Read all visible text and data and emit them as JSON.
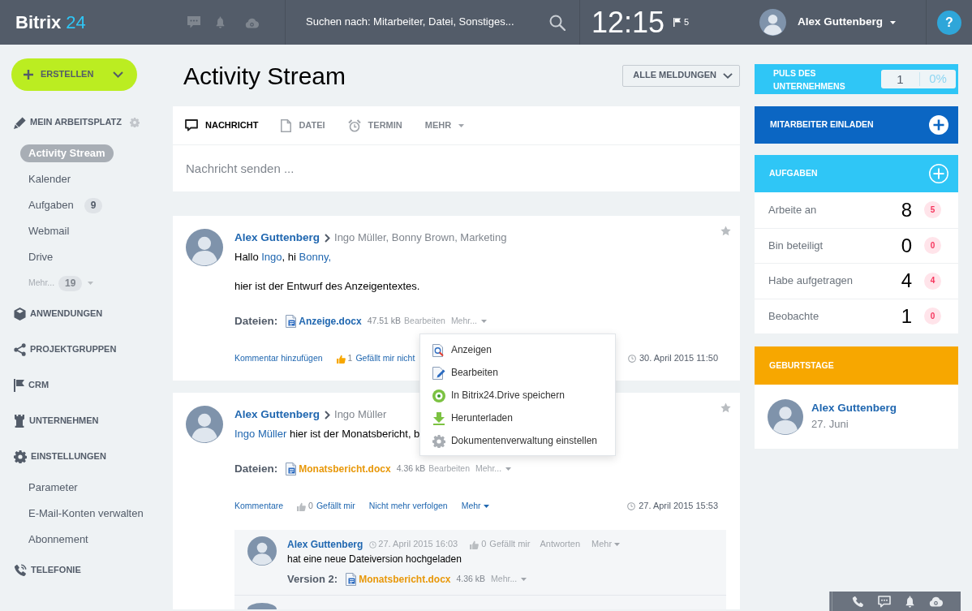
{
  "header": {
    "logo": {
      "text": "Bitrix",
      "number": "24"
    },
    "search": {
      "placeholder": "Suchen nach: Mitarbeiter, Datei, Sonstiges..."
    },
    "clock": "12:15",
    "flag_count": "5",
    "user": {
      "name": "Alex Guttenberg"
    },
    "help": "?"
  },
  "sidebar": {
    "create_button": "ERSTELLEN",
    "sections": [
      {
        "title": "MEIN ARBEITSPLATZ",
        "items": [
          {
            "kind": "link",
            "label": "Activity Stream",
            "selected": true
          },
          {
            "kind": "link",
            "label": "Kalender",
            "selected": false
          },
          {
            "kind": "link",
            "label": "Aufgaben",
            "count": "9",
            "selected": false
          },
          {
            "kind": "link",
            "label": "Webmail",
            "selected": false
          },
          {
            "kind": "link",
            "label": "Drive",
            "selected": false
          },
          {
            "kind": "more",
            "label": "Mehr...",
            "count": "19",
            "selected": false
          }
        ]
      },
      {
        "title": "ANWENDUNGEN"
      },
      {
        "title": "PROJEKTGRUPPEN"
      },
      {
        "title": "CRM"
      },
      {
        "title": "UNTERNEHMEN"
      },
      {
        "title": "EINSTELLUNGEN",
        "items": [
          {
            "kind": "link",
            "label": "Parameter",
            "selected": false
          },
          {
            "kind": "link",
            "label": "E-Mail-Konten verwalten",
            "selected": false
          },
          {
            "kind": "link",
            "label": "Abonnement",
            "selected": false
          }
        ]
      },
      {
        "title": "TELEFONIE"
      }
    ]
  },
  "main": {
    "title": "Activity Stream",
    "filter_button": "ALLE MELDUNGEN",
    "composer": {
      "tabs": [
        {
          "kind": "tab",
          "label": "NACHRICHT",
          "selected": true
        },
        {
          "kind": "tab",
          "label": "DATEI",
          "selected": false
        },
        {
          "kind": "tab",
          "label": "TERMIN",
          "selected": false
        },
        {
          "kind": "menu",
          "label": "MEHR",
          "selected": false
        }
      ],
      "placeholder": "Nachricht senden ..."
    },
    "posts": [
      {
        "author": "Alex Guttenberg",
        "recipients": "Ingo Müller, Bonny Brown, Marketing",
        "paragraphs": [
          [
            {
              "text": "Hallo ",
              "link": false
            },
            {
              "text": "Ingo",
              "link": true
            },
            {
              "text": ", hi ",
              "link": false
            },
            {
              "text": "Bonny,",
              "link": true
            }
          ],
          [
            {
              "text": "hier ist der Entwurf des Anzeigentextes.",
              "link": false
            }
          ]
        ],
        "files": {
          "label": "Dateien:",
          "items": [
            {
              "name": "Anzeige.docx",
              "size": "47.51 kB",
              "edit": "Bearbeiten",
              "more": "Mehr...",
              "color": "#2067b0",
              "menu": {
                "items": [
                  "Anzeigen",
                  "Bearbeiten",
                  "In Bitrix24.Drive speichern",
                  "Herunterladen",
                  "Dokumentenverwaltung einstellen"
                ]
              }
            }
          ]
        },
        "actions": [
          {
            "kind": "link",
            "label": "Kommentar hinzufügen"
          },
          {
            "kind": "like",
            "count": "1",
            "label": "Gefällt mir nicht",
            "liked": true
          }
        ],
        "date": "30. April 2015 11:50"
      },
      {
        "author": "Alex Guttenberg",
        "recipients": "Ingo Müller",
        "paragraphs": [
          [
            {
              "text": "Ingo Müller",
              "link": true
            },
            {
              "text": " hier ist der Monatsbericht, b",
              "link": false
            }
          ]
        ],
        "files": {
          "label": "Dateien:",
          "items": [
            {
              "name": "Monatsbericht.docx",
              "size": "4.36 kB",
              "edit": "Bearbeiten",
              "more": "Mehr...",
              "color": "#e8980a"
            }
          ]
        },
        "actions": [
          {
            "kind": "link",
            "label": "Kommentare"
          },
          {
            "kind": "like",
            "count": "0",
            "label": "Gefällt mir",
            "liked": false
          },
          {
            "kind": "link",
            "label": "Nicht mehr verfolgen"
          },
          {
            "kind": "menu",
            "label": "Mehr"
          }
        ],
        "date": "27. April 2015 15:53",
        "comments": [
          {
            "cut_off": false,
            "author": "Alex Guttenberg",
            "date": "27. April 2015 16:03",
            "like": {
              "count": "0",
              "label": "Gefällt mir",
              "liked": false
            },
            "reply": "Antworten",
            "more": "Mehr",
            "text": "hat eine neue Dateiversion hochgeladen",
            "file_label": "Version 2:",
            "file": {
              "name": "Monatsbericht.docx",
              "size": "4.36 kB",
              "more": "Mehr...",
              "color": "#e8980a"
            }
          },
          {
            "cut_off": true
          }
        ]
      }
    ]
  },
  "right": {
    "pulse": {
      "title": "PULS DES UNTERNEHMENS",
      "count": "1",
      "percent": "0%"
    },
    "invite": {
      "label": "MITARBEITER EINLADEN"
    },
    "tasks": {
      "title": "AUFGABEN",
      "rows": [
        {
          "label": "Arbeite an",
          "count": "8",
          "badge": "5"
        },
        {
          "label": "Bin beteiligt",
          "count": "0",
          "badge": "0"
        },
        {
          "label": "Habe aufgetragen",
          "count": "4",
          "badge": "4"
        },
        {
          "label": "Beobachte",
          "count": "1",
          "badge": "0"
        }
      ]
    },
    "birthdays": {
      "title": "GEBURTSTAGE",
      "people": [
        {
          "name": "Alex Guttenberg",
          "date": "27. Juni"
        }
      ]
    }
  }
}
